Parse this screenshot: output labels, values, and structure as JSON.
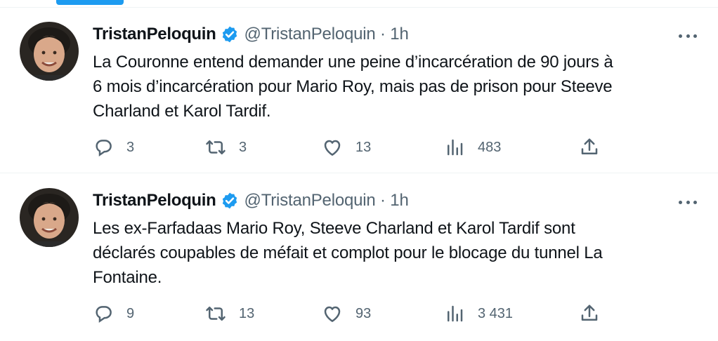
{
  "tweets": [
    {
      "author": "TristanPeloquin",
      "handle_time": "@TristanPeloquin · 1h",
      "text": "La Couronne entend demander une peine d’incarcération de 90 jours à\n6 mois d’incarcération pour Mario Roy, mais pas de prison pour Steeve\nCharland et Karol Tardif.",
      "replies": "3",
      "retweets": "3",
      "likes": "13",
      "views": "483"
    },
    {
      "author": "TristanPeloquin",
      "handle_time": "@TristanPeloquin · 1h",
      "text": "Les ex-Farfadaas Mario Roy, Steeve Charland et Karol Tardif sont\ndéclarés coupables de méfait et complot pour le blocage du tunnel La\nFontaine.",
      "replies": "9",
      "retweets": "13",
      "likes": "93",
      "views": "3 431"
    }
  ],
  "icons": {
    "verified": "verified-badge-icon",
    "more": "more-dots-icon",
    "reply": "reply-icon",
    "retweet": "retweet-icon",
    "like": "heart-icon",
    "views": "views-bar-chart-icon",
    "share": "share-icon"
  },
  "colors": {
    "accent": "#1d9bf0",
    "secondary_text": "#536471",
    "primary_text": "#0f1419"
  }
}
